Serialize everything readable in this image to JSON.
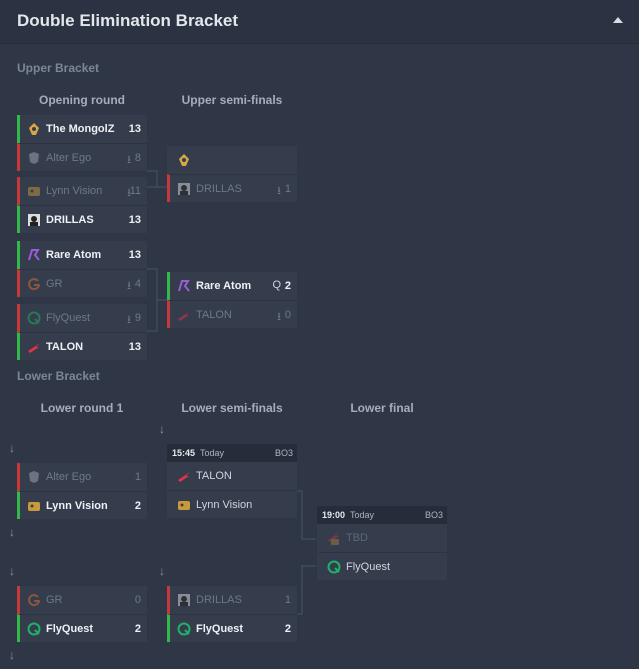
{
  "header": {
    "title": "Double Elimination Bracket"
  },
  "upper": {
    "title": "Upper Bracket",
    "rounds": [
      "Opening round",
      "Upper semi-finals"
    ],
    "opening": [
      {
        "a": {
          "name": "The MongolZ",
          "score": "13"
        },
        "b": {
          "name": "Alter Ego",
          "score": "8"
        }
      },
      {
        "a": {
          "name": "Lynn Vision",
          "score": "11"
        },
        "b": {
          "name": "DRILLAS",
          "score": "13"
        }
      },
      {
        "a": {
          "name": "Rare Atom",
          "score": "13"
        },
        "b": {
          "name": "GR",
          "score": "4"
        }
      },
      {
        "a": {
          "name": "FlyQuest",
          "score": "9"
        },
        "b": {
          "name": "TALON",
          "score": "13"
        }
      }
    ],
    "semis": [
      {
        "a": {
          "name": "",
          "score": ""
        },
        "b": {
          "name": "DRILLAS",
          "score": "1"
        }
      },
      {
        "a": {
          "name": "Rare Atom",
          "flag": "Q",
          "score": "2"
        },
        "b": {
          "name": "TALON",
          "score": "0"
        }
      }
    ]
  },
  "lower": {
    "title": "Lower Bracket",
    "rounds": [
      "Lower round 1",
      "Lower semi-finals",
      "Lower final"
    ],
    "r1": [
      {
        "a": {
          "name": "Alter Ego",
          "score": "1"
        },
        "b": {
          "name": "Lynn Vision",
          "score": "2"
        }
      },
      {
        "a": {
          "name": "GR",
          "score": "0"
        },
        "b": {
          "name": "FlyQuest",
          "score": "2"
        }
      }
    ],
    "semis": [
      {
        "time": "15:45",
        "day": "Today",
        "bo": "BO3",
        "a": {
          "name": "TALON"
        },
        "b": {
          "name": "Lynn Vision"
        }
      },
      {
        "a": {
          "name": "DRILLAS",
          "score": "1"
        },
        "b": {
          "name": "FlyQuest",
          "score": "2"
        }
      }
    ],
    "final": {
      "time": "19:00",
      "day": "Today",
      "bo": "BO3",
      "a": {
        "name": "TBD"
      },
      "b": {
        "name": "FlyQuest"
      }
    }
  },
  "colors": {
    "win": "#33b84a",
    "loss": "#c73838",
    "background": "#2f3746"
  },
  "icons": {
    "mongolz": "mongolz-logo-icon",
    "alterego": "alter-ego-logo-icon",
    "lynn": "lynn-vision-logo-icon",
    "drillas": "drillas-logo-icon",
    "rareatom": "rare-atom-logo-icon",
    "gr": "gr-logo-icon",
    "flyquest": "flyquest-logo-icon",
    "talon": "talon-logo-icon"
  }
}
